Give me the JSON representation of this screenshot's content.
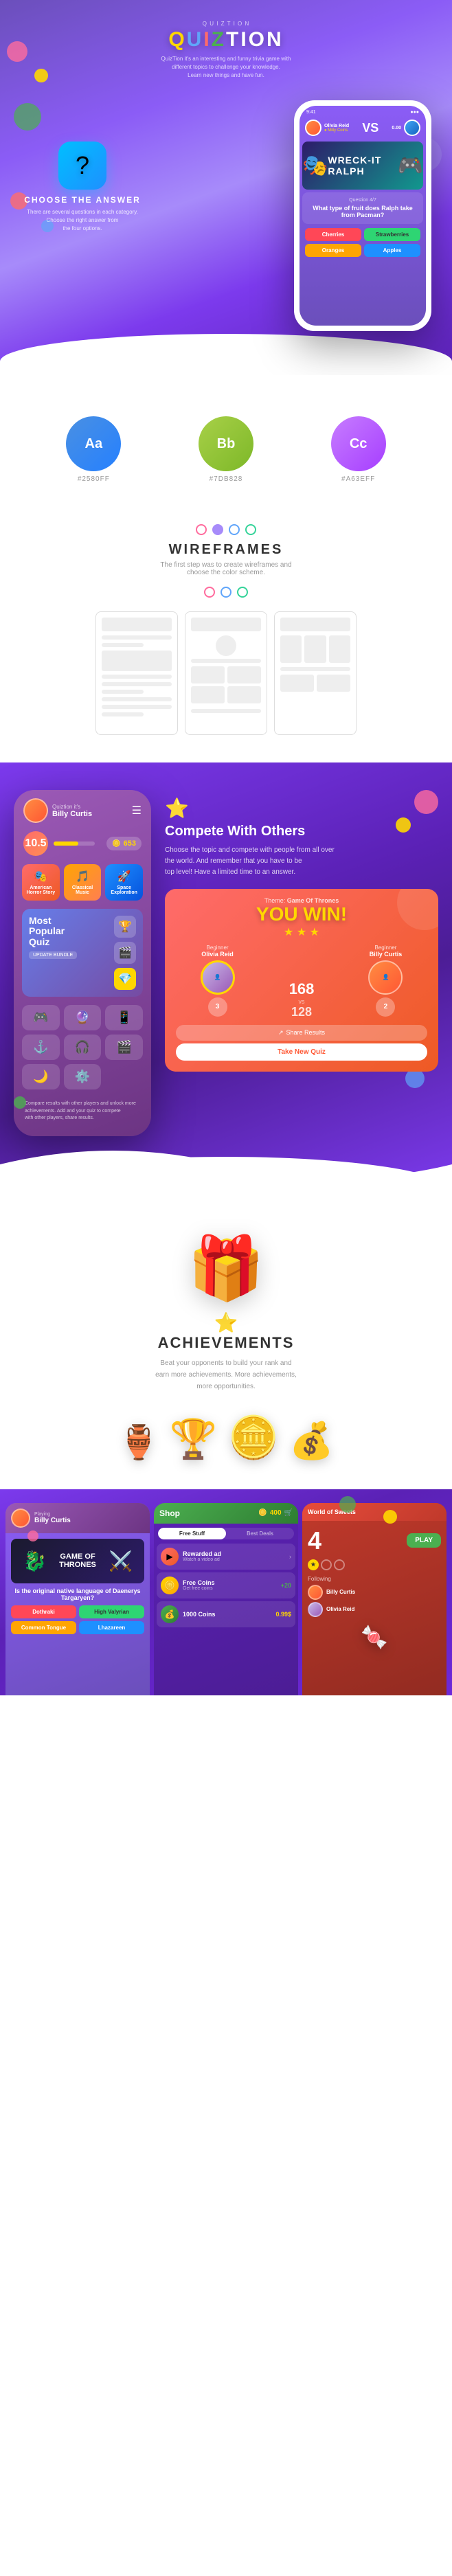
{
  "app": {
    "name": "QuizTion",
    "tagline_line1": "QuizTion it's an interesting and funny trivia game with",
    "tagline_line2": "different topics to challenge your knowledge.",
    "tagline_line3": "Learn new things and have fun."
  },
  "hero": {
    "question_icon": "?",
    "feature_title": "CHOOSE THE ANSWER",
    "feature_desc_line1": "There are several questions in each category.",
    "feature_desc_line2": "Choose the right answer from",
    "feature_desc_line3": "the four options."
  },
  "phone_quiz": {
    "user1_name": "Olivia Reid",
    "user1_coins": "Milly Coins",
    "user2_coins": "0.00",
    "question_num": "Question 4/7",
    "question_text": "What type of fruit does Ralph take from Pacman?",
    "answers": [
      "Cherries",
      "Strawberries",
      "Oranges",
      "Apples"
    ]
  },
  "colors": [
    {
      "label": "Aa",
      "hex": "#2580FF",
      "code": "#2580FF",
      "bg": "#2580FF"
    },
    {
      "label": "Bb",
      "hex": "#7DB828",
      "code": "#7DB828",
      "bg": "#7DB828"
    },
    {
      "label": "Cc",
      "hex": "#A63EFF",
      "code": "#A63EFF",
      "bg": "#A63EFF"
    }
  ],
  "wireframes": {
    "title": "WIREFRAMES",
    "subtitle": "The first step was to create wireframes and",
    "subtitle2": "choose the color scheme."
  },
  "left_phone": {
    "user_subtitle": "Billy Curtis",
    "level": "10.5",
    "score": "653",
    "categories": [
      {
        "label": "American Horror Story",
        "icon": "🎭"
      },
      {
        "label": "Classical Music",
        "icon": "🎵"
      },
      {
        "label": "Space Exploration",
        "icon": "🚀"
      }
    ],
    "popular_quiz_label": "Most Popular Quiz",
    "update_label": "UPDATE BUNDLE",
    "bottom_categories": [
      "🎮",
      "🔮",
      "📱",
      "⚓",
      "🎧",
      "🎬",
      "🌙",
      "⚙️"
    ]
  },
  "compete": {
    "title": "Compete With Others",
    "desc_line1": "Choose the topic and compete with people from all over",
    "desc_line2": "the world. And remember that you have to be",
    "desc_line3": "top level! Have a limited time to an answer."
  },
  "win_card": {
    "theme_label": "Theme:",
    "theme_value": "Game Of Thrones",
    "you_win": "YOU WIN!",
    "player1_label": "Beginner",
    "player1_name": "Olivia Reid",
    "player1_score": "3",
    "player1_total": "168",
    "player2_label": "Beginner",
    "player2_name": "Billy Curtis",
    "player2_score": "2",
    "player2_total": "128",
    "share_btn": "Share Results",
    "new_quiz_btn": "Take New Quiz"
  },
  "achievements": {
    "title": "ACHIEVEMENTS",
    "desc_line1": "Beat your opponents to build your rank and",
    "desc_line2": "earn more achievements. More achievements,",
    "desc_line3": "more opportunities."
  },
  "bottom_screens": {
    "screen1": {
      "type": "quiz_question",
      "user_name": "Billy Curtis",
      "question_text": "Is the original native language of Daenerys Targaryen?"
    },
    "screen2": {
      "type": "shop",
      "title": "Shop",
      "coins": "400",
      "tab_free": "Free Stuff",
      "tab_deals": "Best Deals",
      "items": [
        {
          "name": "Rewarded ad",
          "sub": "Watch a video ad",
          "icon": "▶",
          "color": "#FF6B6B",
          "price": ""
        },
        {
          "name": "Free Coins",
          "sub": "Get free coins",
          "icon": "🪙",
          "color": "#FFD700",
          "price": "+20"
        },
        {
          "name": "1000 Coins",
          "sub": "",
          "icon": "💰",
          "color": "#4CAF50",
          "price": "0.99$"
        }
      ]
    },
    "screen3": {
      "type": "world_of_sweets",
      "title": "World of Sweets",
      "number": "4",
      "play_btn": "PLAY",
      "following_label": "Following",
      "users": [
        {
          "name": "Billy Curtis"
        },
        {
          "name": "Olivia Reid"
        }
      ]
    }
  }
}
